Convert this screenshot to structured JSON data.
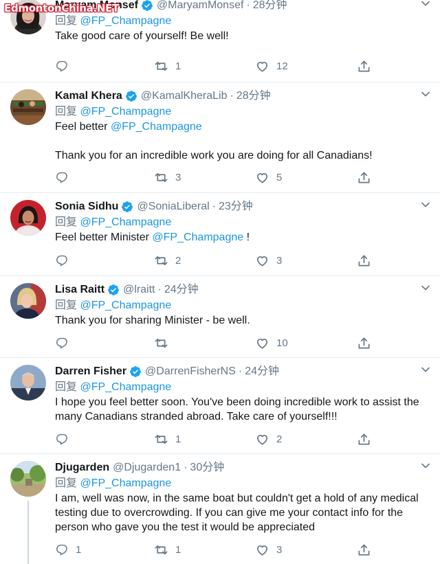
{
  "watermark": "EdmontonChina.NET",
  "reply_prefix": "回复",
  "tweets": [
    {
      "name": "Maryam Monsef",
      "verified": true,
      "handle": "@MaryamMonsef",
      "time": "28分钟",
      "reply_to": "@FP_Champagne",
      "paragraphs": [
        [
          "Take good care of yourself! Be well!"
        ]
      ],
      "replies": "",
      "retweets": "1",
      "likes": "12",
      "avatar": "woman-dark-hair-portrait"
    },
    {
      "name": "Kamal Khera",
      "verified": true,
      "handle": "@KamalKheraLib",
      "time": "28分钟",
      "reply_to": "@FP_Champagne",
      "paragraphs": [
        [
          "Feel better ",
          "@FP_Champagne"
        ],
        [
          ""
        ],
        [
          "Thank you for an incredible work you are doing for all Canadians!"
        ]
      ],
      "replies": "",
      "retweets": "3",
      "likes": "5",
      "avatar": "parliament-chamber-photo"
    },
    {
      "name": "Sonia Sidhu",
      "verified": true,
      "handle": "@SoniaLiberal",
      "time": "23分钟",
      "reply_to": "@FP_Champagne",
      "paragraphs": [
        [
          "Feel better Minister ",
          "@FP_Champagne",
          " !"
        ]
      ],
      "replies": "",
      "retweets": "2",
      "likes": "3",
      "avatar": "woman-red-background"
    },
    {
      "name": "Lisa Raitt",
      "verified": true,
      "handle": "@lraitt",
      "time": "24分钟",
      "reply_to": "@FP_Champagne",
      "paragraphs": [
        [
          "Thank you for sharing Minister - be well."
        ]
      ],
      "replies": "",
      "retweets": "",
      "likes": "10",
      "avatar": "woman-blonde-portrait"
    },
    {
      "name": "Darren Fisher",
      "verified": true,
      "handle": "@DarrenFisherNS",
      "time": "24分钟",
      "reply_to": "@FP_Champagne",
      "paragraphs": [
        [
          "I hope you feel better soon. You've been doing incredible work to assist the many Canadians stranded abroad. Take care of yourself!!!"
        ]
      ],
      "replies": "",
      "retweets": "1",
      "likes": "2",
      "avatar": "man-suit-portrait"
    },
    {
      "name": "Djugarden",
      "verified": false,
      "handle": "@Djugarden1",
      "time": "30分钟",
      "reply_to": "@FP_Champagne",
      "paragraphs": [
        [
          "I am, well was now, in the same boat but couldn't get a hold of any medical testing due to overcrowding. If you can give me your contact info for the person who gave you the test it would be appreciated"
        ]
      ],
      "replies": "1",
      "retweets": "1",
      "likes": "3",
      "avatar": "outdoor-trees-photo"
    }
  ],
  "colors": {
    "accent": "#1b95e0",
    "secondary": "#657786",
    "border": "#e6ecf0",
    "watermark": "#c9162a"
  }
}
